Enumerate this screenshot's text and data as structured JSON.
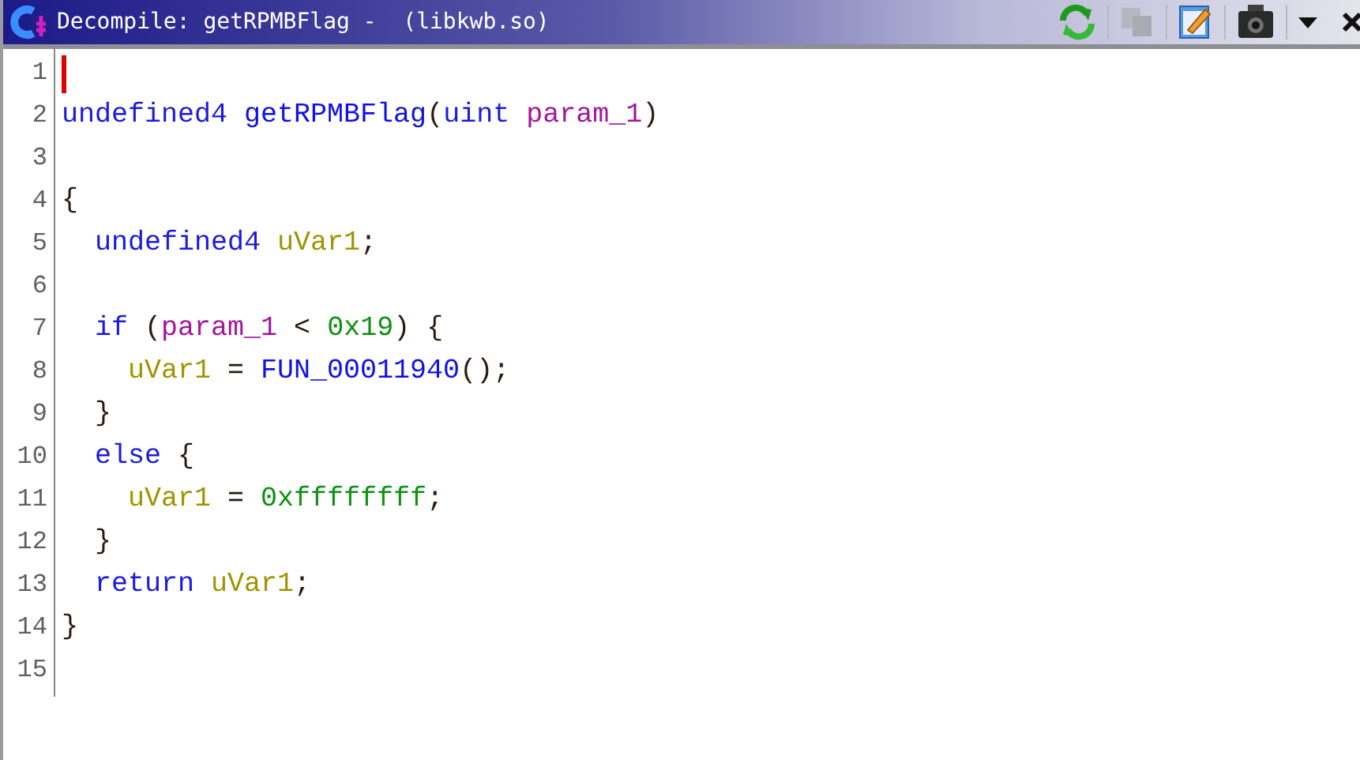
{
  "window": {
    "title": "Decompile: getRPMBFlag -  (libkwb.so)"
  },
  "toolbar": [
    {
      "kind": "refresh",
      "disabled": false
    },
    {
      "kind": "copy",
      "disabled": true
    },
    {
      "kind": "edit",
      "disabled": false
    },
    {
      "kind": "snapshot",
      "disabled": false
    },
    {
      "kind": "menu",
      "disabled": false
    },
    {
      "kind": "close",
      "disabled": false
    }
  ],
  "code": {
    "lines": [
      {
        "number": "1",
        "cursor": true
      },
      {
        "number": "2",
        "cursor": false,
        "tokens": [
          {
            "text": "undefined4 ",
            "kind": "type"
          },
          {
            "text": "getRPMBFlag",
            "kind": "function"
          },
          {
            "text": "(",
            "kind": "plain"
          },
          {
            "text": "uint ",
            "kind": "type"
          },
          {
            "text": "param_1",
            "kind": "param"
          },
          {
            "text": ")",
            "kind": "plain"
          }
        ]
      },
      {
        "number": "3",
        "cursor": false
      },
      {
        "number": "4",
        "cursor": false,
        "tokens": [
          {
            "text": "{",
            "kind": "plain"
          }
        ]
      },
      {
        "number": "5",
        "cursor": false,
        "tokens": [
          {
            "text": "  undefined4 ",
            "kind": "type"
          },
          {
            "text": "uVar1",
            "kind": "variable"
          },
          {
            "text": ";",
            "kind": "plain"
          }
        ]
      },
      {
        "number": "6",
        "cursor": false
      },
      {
        "number": "7",
        "cursor": false,
        "tokens": [
          {
            "text": "  if",
            "kind": "keyword"
          },
          {
            "text": " (",
            "kind": "plain"
          },
          {
            "text": "param_1",
            "kind": "param"
          },
          {
            "text": " < ",
            "kind": "plain"
          },
          {
            "text": "0x19",
            "kind": "constant"
          },
          {
            "text": ") {",
            "kind": "plain"
          }
        ]
      },
      {
        "number": "8",
        "cursor": false,
        "tokens": [
          {
            "text": "    uVar1",
            "kind": "variable"
          },
          {
            "text": " = ",
            "kind": "plain"
          },
          {
            "text": "FUN_00011940",
            "kind": "function"
          },
          {
            "text": "();",
            "kind": "plain"
          }
        ]
      },
      {
        "number": "9",
        "cursor": false,
        "tokens": [
          {
            "text": "  }",
            "kind": "plain"
          }
        ]
      },
      {
        "number": "10",
        "cursor": false,
        "tokens": [
          {
            "text": "  else",
            "kind": "keyword"
          },
          {
            "text": " {",
            "kind": "plain"
          }
        ]
      },
      {
        "number": "11",
        "cursor": false,
        "tokens": [
          {
            "text": "    uVar1",
            "kind": "variable"
          },
          {
            "text": " = ",
            "kind": "plain"
          },
          {
            "text": "0xffffffff",
            "kind": "constant"
          },
          {
            "text": ";",
            "kind": "plain"
          }
        ]
      },
      {
        "number": "12",
        "cursor": false,
        "tokens": [
          {
            "text": "  }",
            "kind": "plain"
          }
        ]
      },
      {
        "number": "13",
        "cursor": false,
        "tokens": [
          {
            "text": "  return ",
            "kind": "keyword"
          },
          {
            "text": "uVar1",
            "kind": "variable"
          },
          {
            "text": ";",
            "kind": "plain"
          }
        ]
      },
      {
        "number": "14",
        "cursor": false,
        "tokens": [
          {
            "text": "}",
            "kind": "plain"
          }
        ]
      },
      {
        "number": "15",
        "cursor": false
      }
    ]
  }
}
